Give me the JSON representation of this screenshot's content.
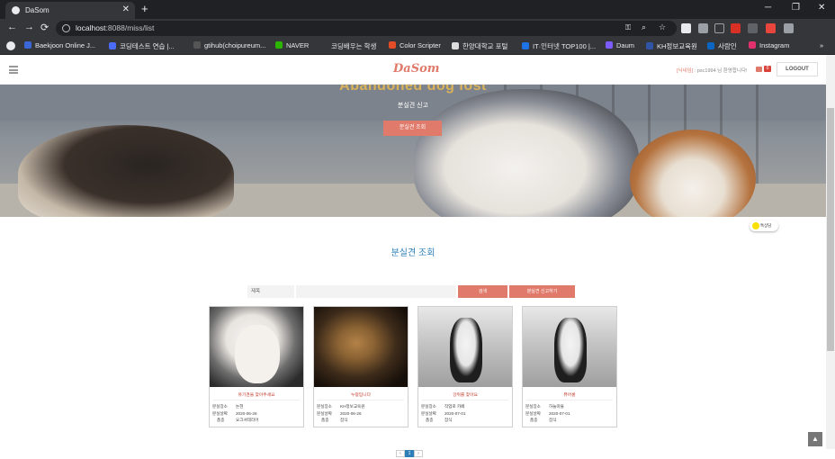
{
  "browser": {
    "tab_title": "DaSom",
    "tab_close": "✕",
    "new_tab": "+",
    "url_host": "localhost",
    "url_path": ":8088/miss/list",
    "win_min": "─",
    "win_max": "❐",
    "win_close": "✕",
    "back": "←",
    "forward": "→",
    "reload": "⟳",
    "profile": "토마",
    "bookmarks": [
      {
        "label": "Baekjoon Online J...",
        "color": "#3a66d8"
      },
      {
        "label": "코딩테스트 연습 |...",
        "color": "#4a6cf7"
      },
      {
        "label": "gtihub(choipureum...",
        "color": "#555555"
      },
      {
        "label": "NAVER",
        "color": "#2db400"
      },
      {
        "label": "코딩배우는 학생",
        "color": "#35363a"
      },
      {
        "label": "Color Scripter",
        "color": "#e34c26"
      },
      {
        "label": "한양대학교 포털",
        "color": "#dddddd"
      },
      {
        "label": "IT·인터넷 TOP100 |...",
        "color": "#1e73e8"
      },
      {
        "label": "Daum",
        "color": "#7c5cff"
      },
      {
        "label": "KH정보교육원",
        "color": "#3155a6"
      },
      {
        "label": "사람인",
        "color": "#0a66c2"
      },
      {
        "label": "Instagram",
        "color": "#e1306c"
      }
    ],
    "bookmarks_more": "»"
  },
  "header": {
    "logo": "DaSom",
    "welcome_nick": "[닉네임]",
    "welcome_text": " : psc1994 님 환영합니다!",
    "mail_count": "0",
    "logout": "LOGOUT"
  },
  "hero": {
    "title": "Abandoned dog lost",
    "subtitle": "분실견 신고",
    "button": "분실견 조회"
  },
  "kakao": {
    "label": "톡상담"
  },
  "section_title": "분실견 조회",
  "search": {
    "select_label": "제목",
    "input_value": "",
    "search_button": "검색",
    "report_button": "분실견 신고하기"
  },
  "cards": [
    {
      "name": "유기견을 찾아주세요",
      "place_k": "분실장소",
      "place_v": "논현",
      "date_k": "분실날짜",
      "date_v": "2020-06-26",
      "breed_k": "품종",
      "breed_v": "요크셔테리어"
    },
    {
      "name": "누렁입니다",
      "place_k": "분실장소",
      "place_v": "KH정보교육원",
      "date_k": "분실날짜",
      "date_v": "2020-06-26",
      "breed_k": "품종",
      "breed_v": "잡식"
    },
    {
      "name": "강쥐를 찾아요",
      "place_k": "분실장소",
      "place_v": "작업로 카페",
      "date_k": "분실날짜",
      "date_v": "2020-07-01",
      "breed_k": "품종",
      "breed_v": "잡식"
    },
    {
      "name": "퓨어롱",
      "place_k": "분실장소",
      "place_v": "하늘마을",
      "date_k": "분실날짜",
      "date_v": "2020-07-01",
      "breed_k": "품종",
      "breed_v": "잡식"
    }
  ],
  "pager": {
    "prev": "‹",
    "current": "1",
    "next": "›"
  },
  "to_top": "▲"
}
